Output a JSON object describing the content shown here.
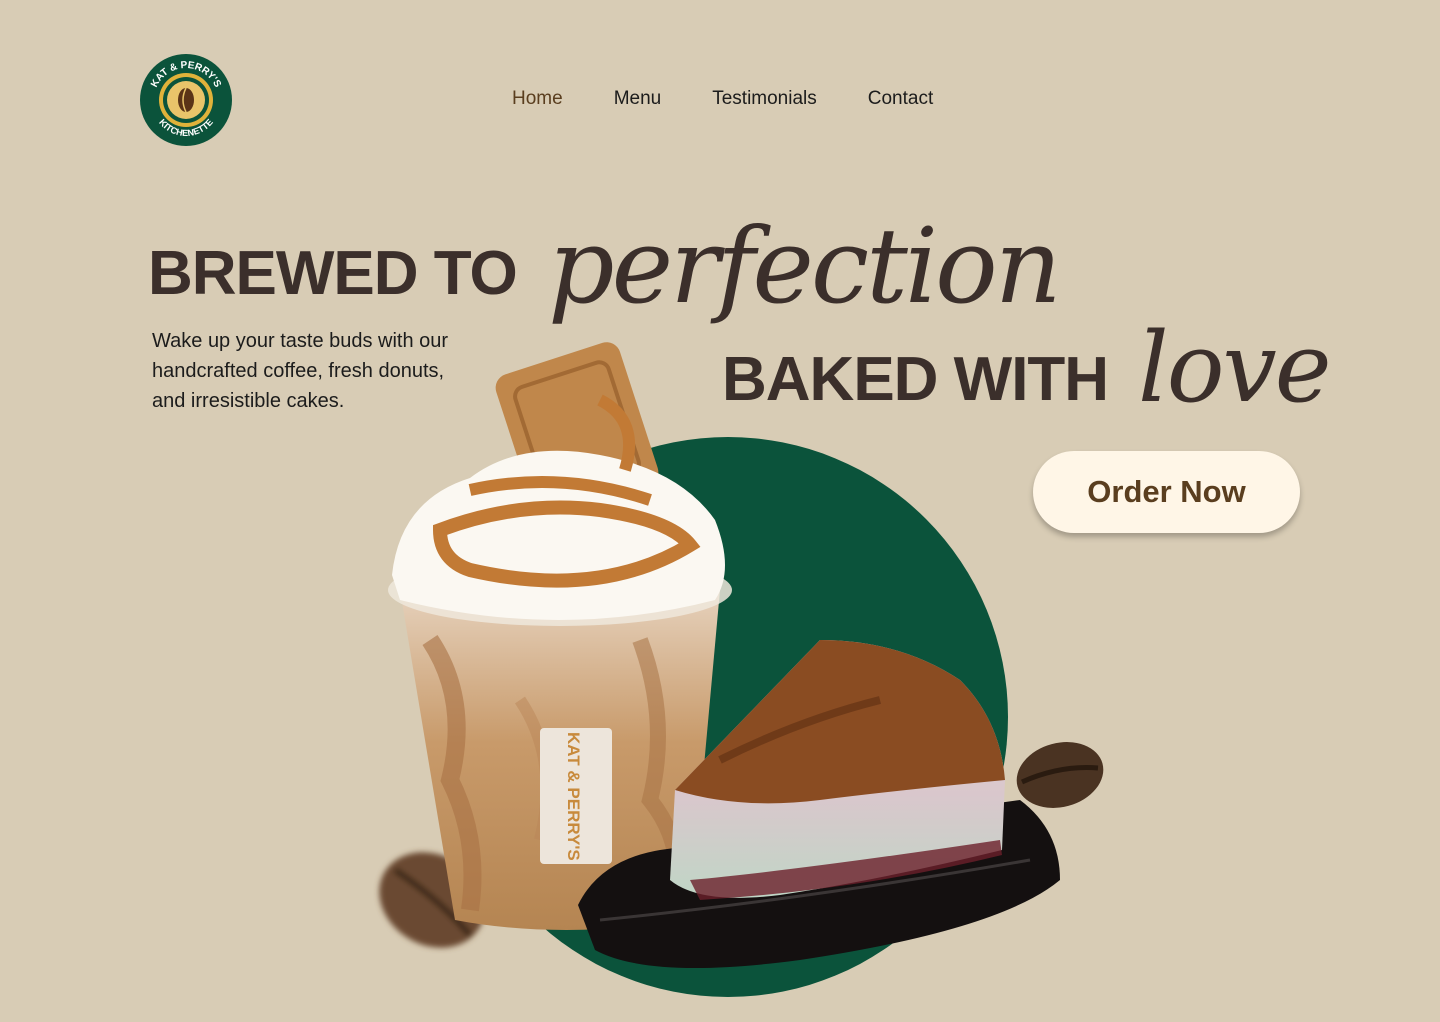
{
  "brand": {
    "name": "Kat & Perry's Kitchenette",
    "logo_top": "KAT & PERRY'S",
    "logo_bottom": "KITCHENETTE"
  },
  "nav": {
    "items": [
      {
        "label": "Home",
        "active": true
      },
      {
        "label": "Menu"
      },
      {
        "label": "Testimonials"
      },
      {
        "label": "Contact"
      }
    ]
  },
  "hero": {
    "line1": "BREWED TO",
    "line1_script": "perfection",
    "line2": "BAKED WITH",
    "line2_script": "love",
    "tagline": "Wake up your taste buds with our handcrafted coffee, fresh donuts, and irresistible cakes.",
    "cta": "Order Now",
    "cup_label": "KAT & PERRY'S"
  },
  "colors": {
    "background": "#d8ccb5",
    "accent_green": "#0b533b",
    "text_dark": "#3b2f2b",
    "button_bg": "#fff6e7",
    "button_text": "#5a3e1f"
  }
}
